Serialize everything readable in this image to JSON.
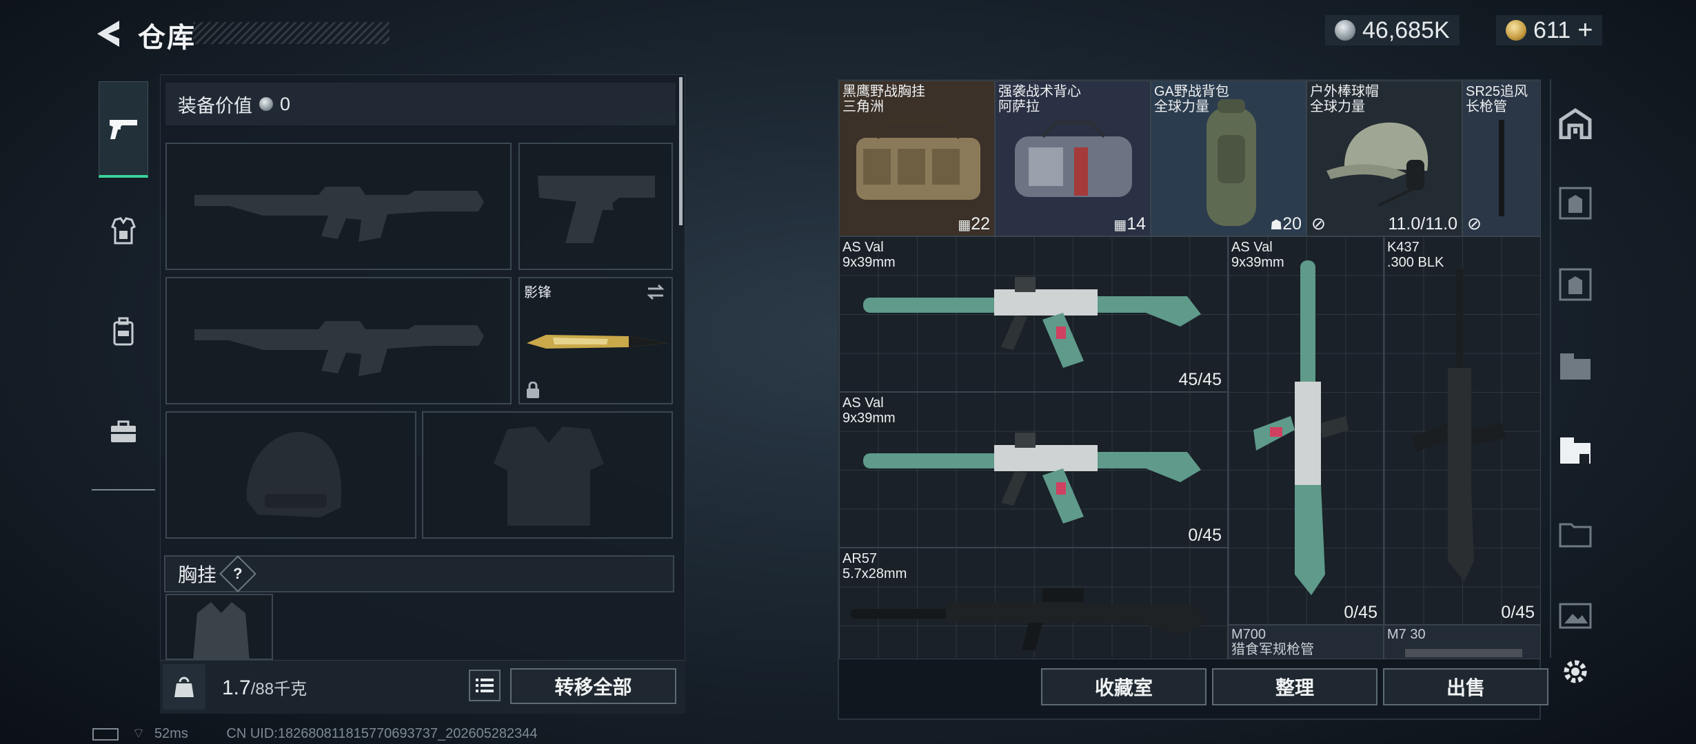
{
  "header": {
    "title": "仓库",
    "currency_main": "46,685K",
    "currency_premium": "611",
    "currency_premium_plus": "+"
  },
  "left_panel": {
    "equipment_value_label": "装备价值",
    "equipment_value": "0",
    "melee_name": "影锋",
    "chest_section_label": "胸挂",
    "chest_section_help": "?",
    "weight_current": "1.7",
    "weight_max": "/88千克",
    "transfer_all_label": "转移全部"
  },
  "stash": {
    "top_items": [
      {
        "line1": "黑鹰野战胸挂",
        "line2": "三角洲",
        "count": "22"
      },
      {
        "line1": "强袭战术背心",
        "line2": "阿萨拉",
        "count": "14"
      },
      {
        "line1": "GA野战背包",
        "line2": "全球力量",
        "count": "20"
      },
      {
        "line1": "户外棒球帽",
        "line2": "全球力量",
        "count": "11.0/11.0"
      },
      {
        "line1": "SR25追风",
        "line2": "长枪管",
        "count": ""
      }
    ],
    "weapons": [
      {
        "name": "AS Val",
        "ammo": "9x39mm",
        "count": "45/45"
      },
      {
        "name": "AS Val",
        "ammo": "9x39mm",
        "count": "0/45"
      },
      {
        "name": "AR57",
        "ammo": "5.7x28mm",
        "count": ""
      },
      {
        "name": "AS Val",
        "ammo": "9x39mm",
        "count": "0/45"
      },
      {
        "name": "K437",
        "ammo": ".300 BLK",
        "count": "0/45"
      },
      {
        "name": "M700",
        "ammo": "猎食军规枪管",
        "count": ""
      },
      {
        "name": "M7 30",
        "ammo": "",
        "count": ""
      }
    ],
    "buttons": {
      "collection": "收藏室",
      "organize": "整理",
      "sell": "出售"
    }
  },
  "footer": {
    "ping": "52ms",
    "uid": "CN UID:1826808118157706937​37_202605282344"
  },
  "colors": {
    "accent": "#3bd39a",
    "background": "#1a2430",
    "panel": "#161d25"
  }
}
